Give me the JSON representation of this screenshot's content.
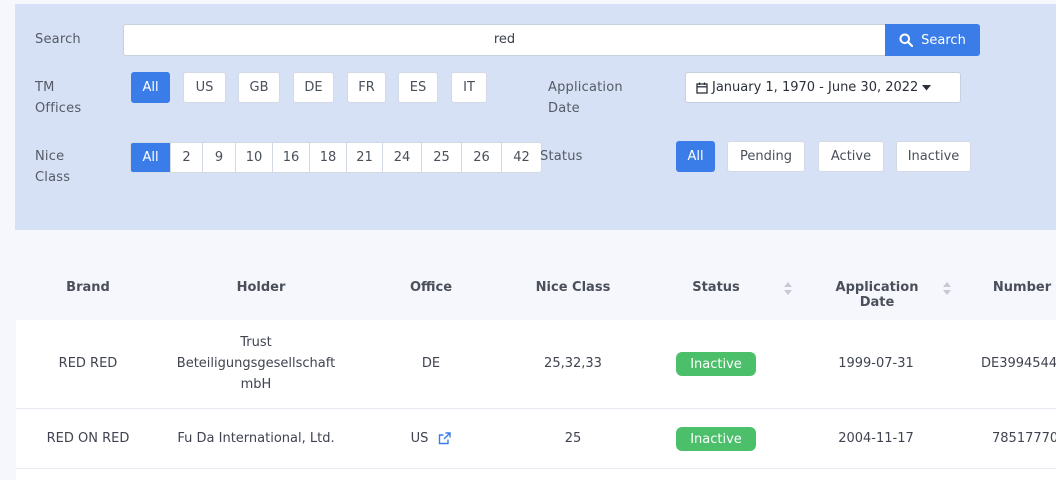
{
  "search": {
    "label": "Search",
    "value": "red",
    "button_label": "Search"
  },
  "offices": {
    "label_line1": "TM",
    "label_line2": "Offices",
    "options": [
      "All",
      "US",
      "GB",
      "DE",
      "FR",
      "ES",
      "IT"
    ]
  },
  "nice_class": {
    "label_line1": "Nice",
    "label_line2": "Class",
    "options": [
      "All",
      "2",
      "9",
      "10",
      "16",
      "18",
      "21",
      "24",
      "25",
      "26",
      "42"
    ]
  },
  "application_date": {
    "label_line1": "Application",
    "label_line2": "Date",
    "value": "January 1, 1970 - June 30, 2022"
  },
  "status_filter": {
    "label": "Status",
    "options": [
      "All",
      "Pending",
      "Active",
      "Inactive"
    ]
  },
  "table": {
    "headers": {
      "brand": "Brand",
      "holder": "Holder",
      "office": "Office",
      "nice_class": "Nice Class",
      "status": "Status",
      "application_date": "Application Date",
      "number": "Number"
    },
    "rows": [
      {
        "brand": "RED RED",
        "holder_line1": "Trust",
        "holder_line2": "Beteiligungsgesellschaft",
        "holder_line3": "mbH",
        "office": "DE",
        "nice_class": "25,32,33",
        "status": "Inactive",
        "application_date": "1999-07-31",
        "number": "DE3994544"
      },
      {
        "brand": "RED ON RED",
        "holder": "Fu Da International, Ltd.",
        "office": "US",
        "nice_class": "25",
        "status": "Inactive",
        "application_date": "2004-11-17",
        "number": "78517770"
      }
    ]
  },
  "colors": {
    "accent": "#3b7de8",
    "panel": "#d6e1f5",
    "status_inactive": "#4cbf6b"
  }
}
